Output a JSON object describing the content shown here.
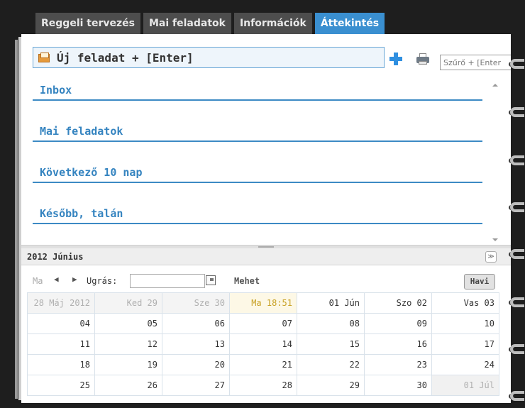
{
  "tabs": [
    {
      "label": "Reggeli tervezés",
      "active": false
    },
    {
      "label": "Mai feladatok",
      "active": false
    },
    {
      "label": "Információk",
      "active": false
    },
    {
      "label": "Áttekintés",
      "active": true
    }
  ],
  "new_task": {
    "placeholder": "Új feladat + [Enter]"
  },
  "filter": {
    "placeholder": "Szűrő + [Enter"
  },
  "sections": [
    {
      "label": "Inbox"
    },
    {
      "label": "Mai feladatok"
    },
    {
      "label": "Következő 10 nap"
    },
    {
      "label": "Később, talán"
    }
  ],
  "calendar": {
    "title": "2012 Június",
    "toolbar": {
      "today_label": "Ma",
      "jump_label": "Ugrás:",
      "go_label": "Mehet",
      "monthly_label": "Havi"
    },
    "weeks": [
      [
        "28 Máj 2012",
        "Ked 29",
        "Sze 30",
        "Ma 18:51",
        "01 Jún",
        "Szo 02",
        "Vas 03"
      ],
      [
        "04",
        "05",
        "06",
        "07",
        "08",
        "09",
        "10"
      ],
      [
        "11",
        "12",
        "13",
        "14",
        "15",
        "16",
        "17"
      ],
      [
        "18",
        "19",
        "20",
        "21",
        "22",
        "23",
        "24"
      ],
      [
        "25",
        "26",
        "27",
        "28",
        "29",
        "30",
        "01 Júl"
      ]
    ]
  },
  "colors": {
    "accent": "#3a8fd0",
    "section_text": "#3584c0",
    "today_text": "#c9a227",
    "background": "#1e1e1e"
  }
}
